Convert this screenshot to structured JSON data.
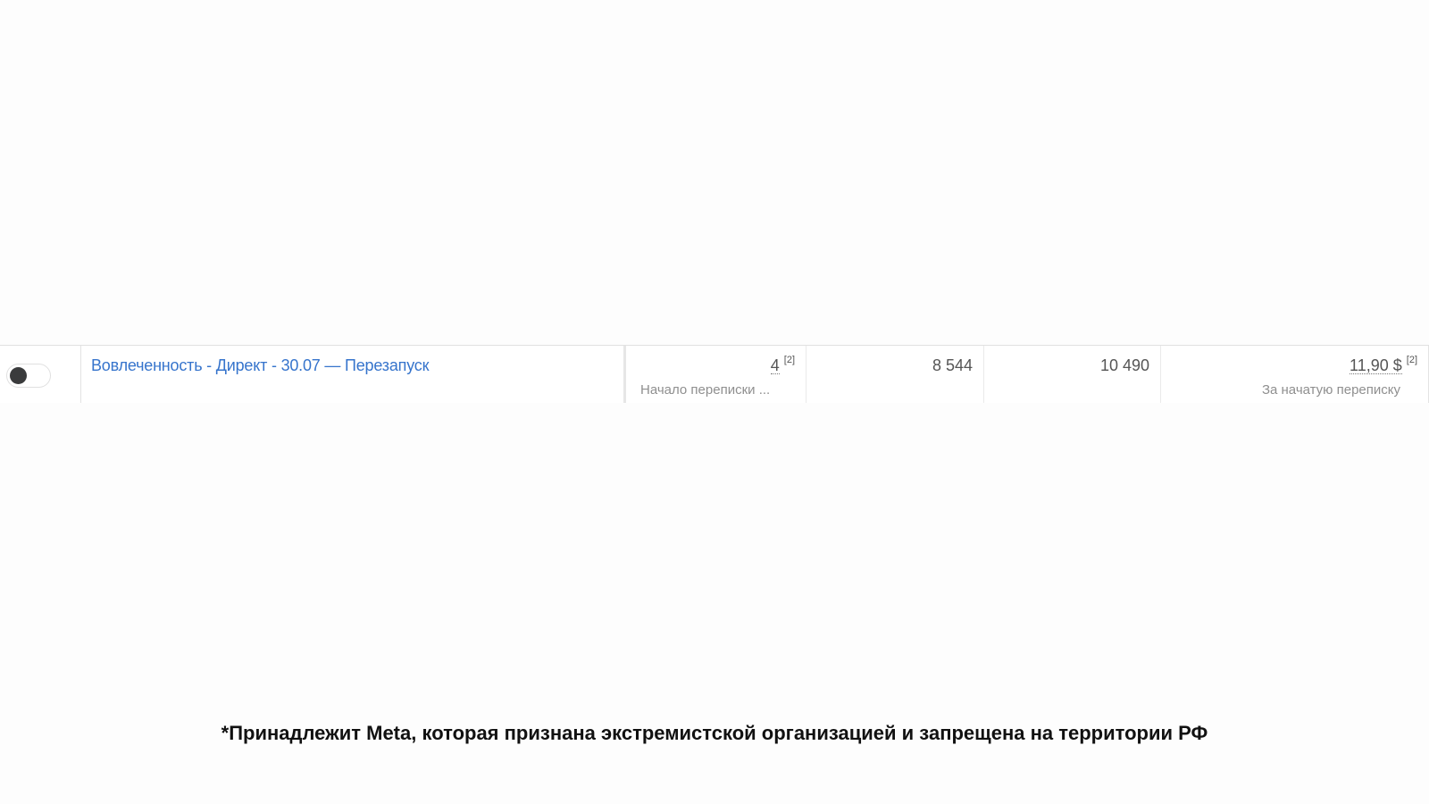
{
  "ad_row": {
    "toggle": {
      "state": "off",
      "knob_color": "#3a3b3c"
    },
    "name": "Вовлеченность - Директ - 30.07 — Перезапуск",
    "name_color": "#3674cc",
    "metrics": [
      {
        "value": "4",
        "footnote": "[2]",
        "label": "Начало переписки ..."
      },
      {
        "value": "8 544"
      },
      {
        "value": "10 490"
      },
      {
        "value": "11,90 $",
        "footnote": "[2]",
        "label": "За начатую переписку"
      }
    ]
  },
  "disclaimer": "*Принадлежит Meta, которая признана экстремистской организацией и запрещена на территории РФ"
}
